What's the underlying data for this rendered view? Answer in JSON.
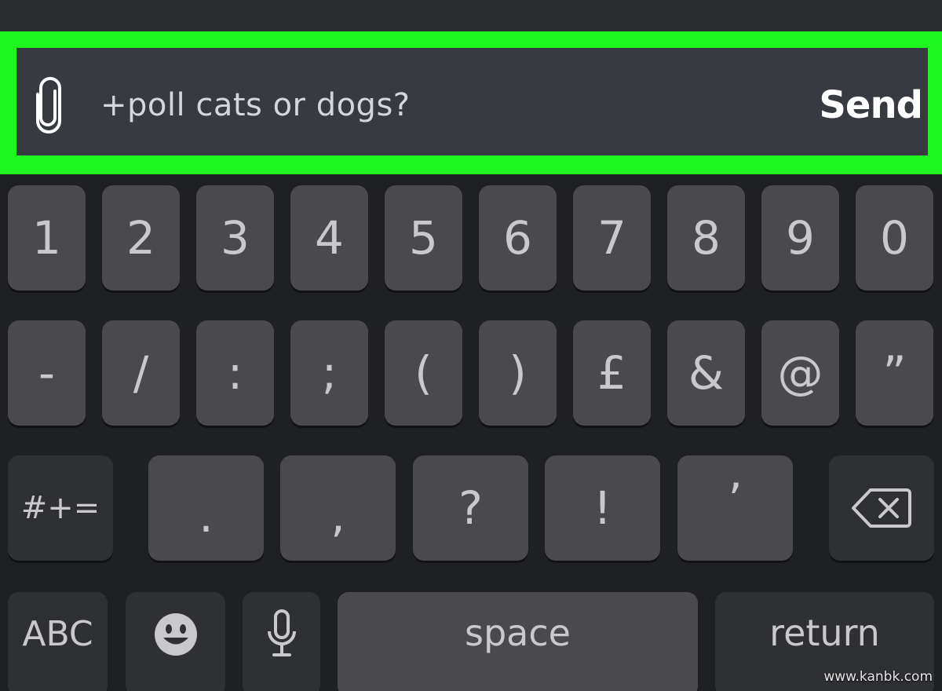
{
  "composer": {
    "message_value": "+poll cats or dogs?",
    "send_label": "Send",
    "highlight_color": "#1ff51f"
  },
  "keyboard": {
    "row1": [
      "1",
      "2",
      "3",
      "4",
      "5",
      "6",
      "7",
      "8",
      "9",
      "0"
    ],
    "row2": [
      "-",
      "/",
      ":",
      ";",
      "(",
      ")",
      "£",
      "&",
      "@",
      "”"
    ],
    "row3": {
      "symbols_label": "#+=",
      "keys": [
        ".",
        ",",
        "?",
        "!",
        "’"
      ]
    },
    "row4": {
      "abc_label": "ABC",
      "space_label": "space",
      "return_label": "return"
    }
  },
  "watermark": "www.kanbk.com",
  "icons": [
    "paperclip-icon",
    "backspace-icon",
    "emoji-icon",
    "microphone-icon"
  ]
}
